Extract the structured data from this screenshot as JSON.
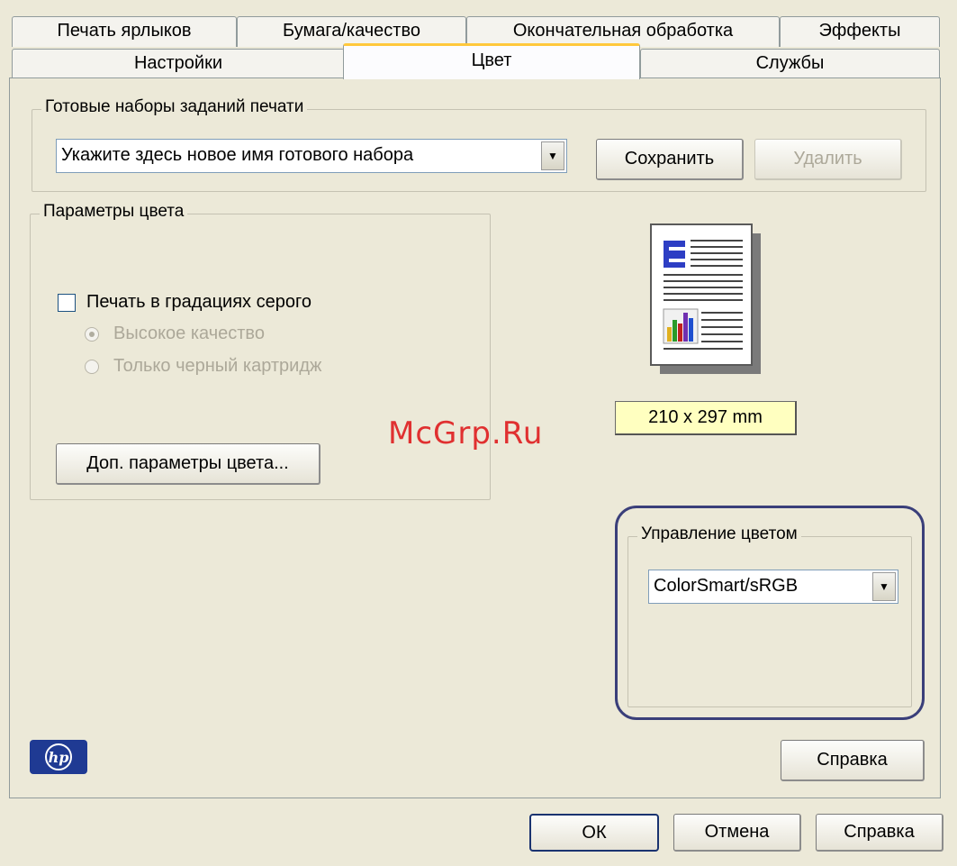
{
  "tabs_row1": [
    "Печать ярлыков",
    "Бумага/качество",
    "Окончательная обработка",
    "Эффекты"
  ],
  "tabs_row2": [
    "Настройки",
    "Цвет",
    "Службы"
  ],
  "active_tab": "Цвет",
  "presets": {
    "legend": "Готовые наборы заданий печати",
    "combo_value": "Укажите здесь новое имя готового набора",
    "save_label": "Сохранить",
    "delete_label": "Удалить"
  },
  "color_options": {
    "legend": "Параметры цвета",
    "grayscale_label": "Печать в градациях серого",
    "grayscale_checked": false,
    "radio_high_quality": "Высокое качество",
    "radio_black_only": "Только черный картридж",
    "advanced_button": "Доп. параметры цвета..."
  },
  "paper_size": "210 x 297 mm",
  "watermark": "McGrp.Ru",
  "color_management": {
    "legend": "Управление цветом",
    "combo_value": "ColorSmart/sRGB"
  },
  "help_inner_label": "Справка",
  "logo_text": "hp",
  "footer": {
    "ok_label": "ОК",
    "cancel_label": "Отмена",
    "help_label": "Справка"
  },
  "colors": {
    "highlight_border": "#3a3f7a",
    "active_tab_accent": "#ffc83c",
    "paper_label_bg": "#ffffc0",
    "hp_blue": "#1f3a93"
  }
}
